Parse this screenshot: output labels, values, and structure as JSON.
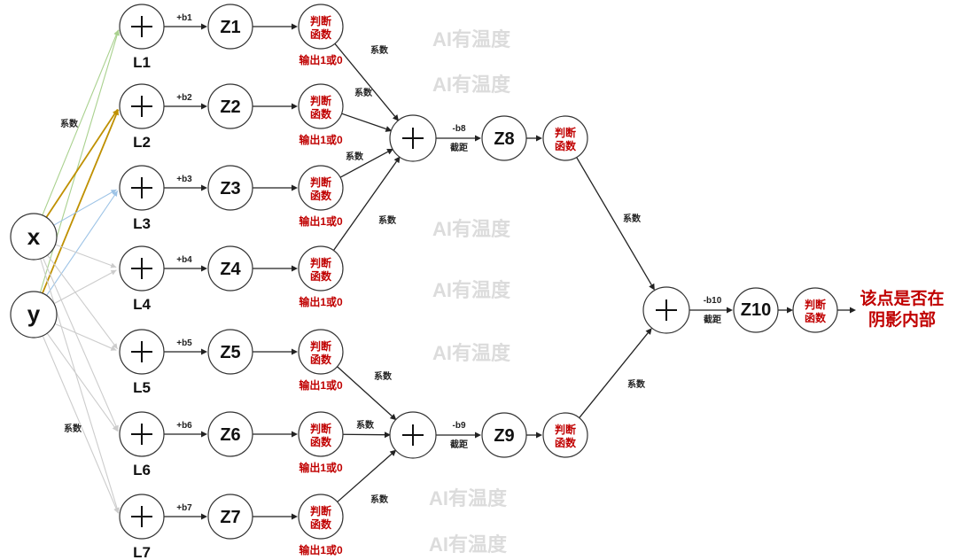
{
  "inputs": {
    "x": "x",
    "y": "y"
  },
  "layers": [
    {
      "label": "L1",
      "bias": "+b1",
      "z": "Z1"
    },
    {
      "label": "L2",
      "bias": "+b2",
      "z": "Z2"
    },
    {
      "label": "L3",
      "bias": "+b3",
      "z": "Z3"
    },
    {
      "label": "L4",
      "bias": "+b4",
      "z": "Z4"
    },
    {
      "label": "L5",
      "bias": "+b5",
      "z": "Z5"
    },
    {
      "label": "L6",
      "bias": "+b6",
      "z": "Z6"
    },
    {
      "label": "L7",
      "bias": "+b7",
      "z": "Z7"
    }
  ],
  "judge": {
    "line1": "判断",
    "line2": "函数"
  },
  "output_text": "输出1或0",
  "coef_label": "系数",
  "intercept_label": "截距",
  "hidden2": [
    {
      "bias": "-b8",
      "z": "Z8"
    },
    {
      "bias": "-b9",
      "z": "Z9"
    }
  ],
  "final": {
    "bias": "-b10",
    "z": "Z10"
  },
  "result": {
    "line1": "该点是否在",
    "line2": "阴影内部"
  },
  "watermark": "AI有温度",
  "colors": {
    "red": "#c00000",
    "green_line": "#a9d18e",
    "gold_line": "#bf9000",
    "blue_line": "#9dc3e6",
    "gray_line": "#cccccc",
    "watermark": "#dcdcdc"
  }
}
